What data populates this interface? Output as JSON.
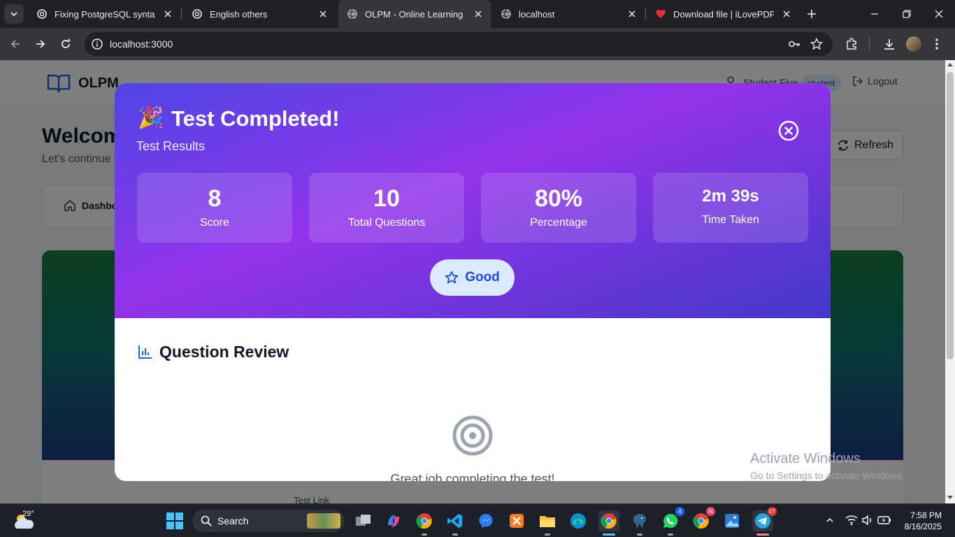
{
  "browser": {
    "tabs": [
      {
        "title": "Fixing PostgreSQL syntax err",
        "icon": "openai-icon"
      },
      {
        "title": "English others",
        "icon": "openai-icon"
      },
      {
        "title": "OLPM - Online Learning Platf",
        "icon": "globe-icon"
      },
      {
        "title": "localhost",
        "icon": "globe-icon"
      },
      {
        "title": "Download file | iLovePDF",
        "icon": "heart-icon"
      }
    ],
    "url": "localhost:3000"
  },
  "app": {
    "brand": "OLPM",
    "user_name": "Student Five",
    "role": "student",
    "logout_label": "Logout",
    "welcome_title": "Welcome back, Student Five!",
    "welcome_sub": "Let's continue your learning journey",
    "refresh_label": "Refresh",
    "dashboard_tab": "Dashboard",
    "test_link_label": "Test Link"
  },
  "modal": {
    "emoji": "🎉",
    "title": "Test Completed!",
    "subtitle": "Test Results",
    "stats": [
      {
        "value": "8",
        "label": "Score"
      },
      {
        "value": "10",
        "label": "Total Questions"
      },
      {
        "value": "80%",
        "label": "Percentage"
      },
      {
        "value": "2m 39s",
        "label": "Time Taken"
      }
    ],
    "grade": "Good",
    "review_title": "Question Review",
    "review_message": "Great job completing the test!"
  },
  "windows_watermark": {
    "line1": "Activate Windows",
    "line2": "Go to Settings to activate Windows."
  },
  "taskbar": {
    "temperature": "29°",
    "search_placeholder": "Search",
    "time": "7:58 PM",
    "date": "8/16/2025",
    "whatsapp_badge": "4",
    "chrome_badge": "N",
    "telegram_badge": "07"
  },
  "colors": {
    "modal_gradient_start": "#4f46e5",
    "modal_gradient_mid": "#9333ea",
    "grade_pill_bg": "#dbeafe",
    "grade_pill_text": "#1d4ed8"
  }
}
